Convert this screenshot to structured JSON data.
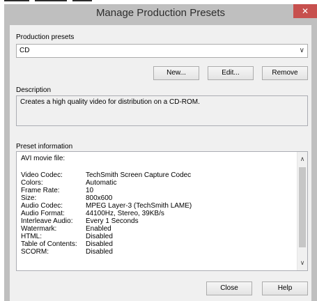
{
  "window": {
    "title": "Manage Production Presets",
    "close_glyph": "✕"
  },
  "presets": {
    "label": "Production presets",
    "selected": "CD",
    "arrow_icon": "chevron-down-icon"
  },
  "buttons": {
    "new": "New...",
    "edit": "Edit...",
    "remove": "Remove",
    "close": "Close",
    "help": "Help"
  },
  "description": {
    "label": "Description",
    "text": "Creates a high quality video for distribution on a CD-ROM."
  },
  "preset_info": {
    "label": "Preset information",
    "header": "AVI movie file:",
    "rows": [
      {
        "key": "Video Codec:",
        "value": "TechSmith Screen Capture Codec"
      },
      {
        "key": "Colors:",
        "value": "Automatic"
      },
      {
        "key": "Frame Rate:",
        "value": "10"
      },
      {
        "key": "Size:",
        "value": "800x600"
      },
      {
        "key": "Audio Codec:",
        "value": "MPEG Layer-3 (TechSmith LAME)"
      },
      {
        "key": "Audio Format:",
        "value": "44100Hz, Stereo, 39KB/s"
      },
      {
        "key": "Interleave Audio:",
        "value": "Every 1 Seconds"
      },
      {
        "key": "Watermark:",
        "value": "Enabled"
      },
      {
        "key": "HTML:",
        "value": "Disabled"
      },
      {
        "key": "Table of Contents:",
        "value": "Disabled"
      },
      {
        "key": "SCORM:",
        "value": "Disabled"
      }
    ]
  },
  "colors": {
    "titlebar": "#bfbfbf",
    "close_button": "#c7504e",
    "client_bg": "#f0f0f0"
  }
}
